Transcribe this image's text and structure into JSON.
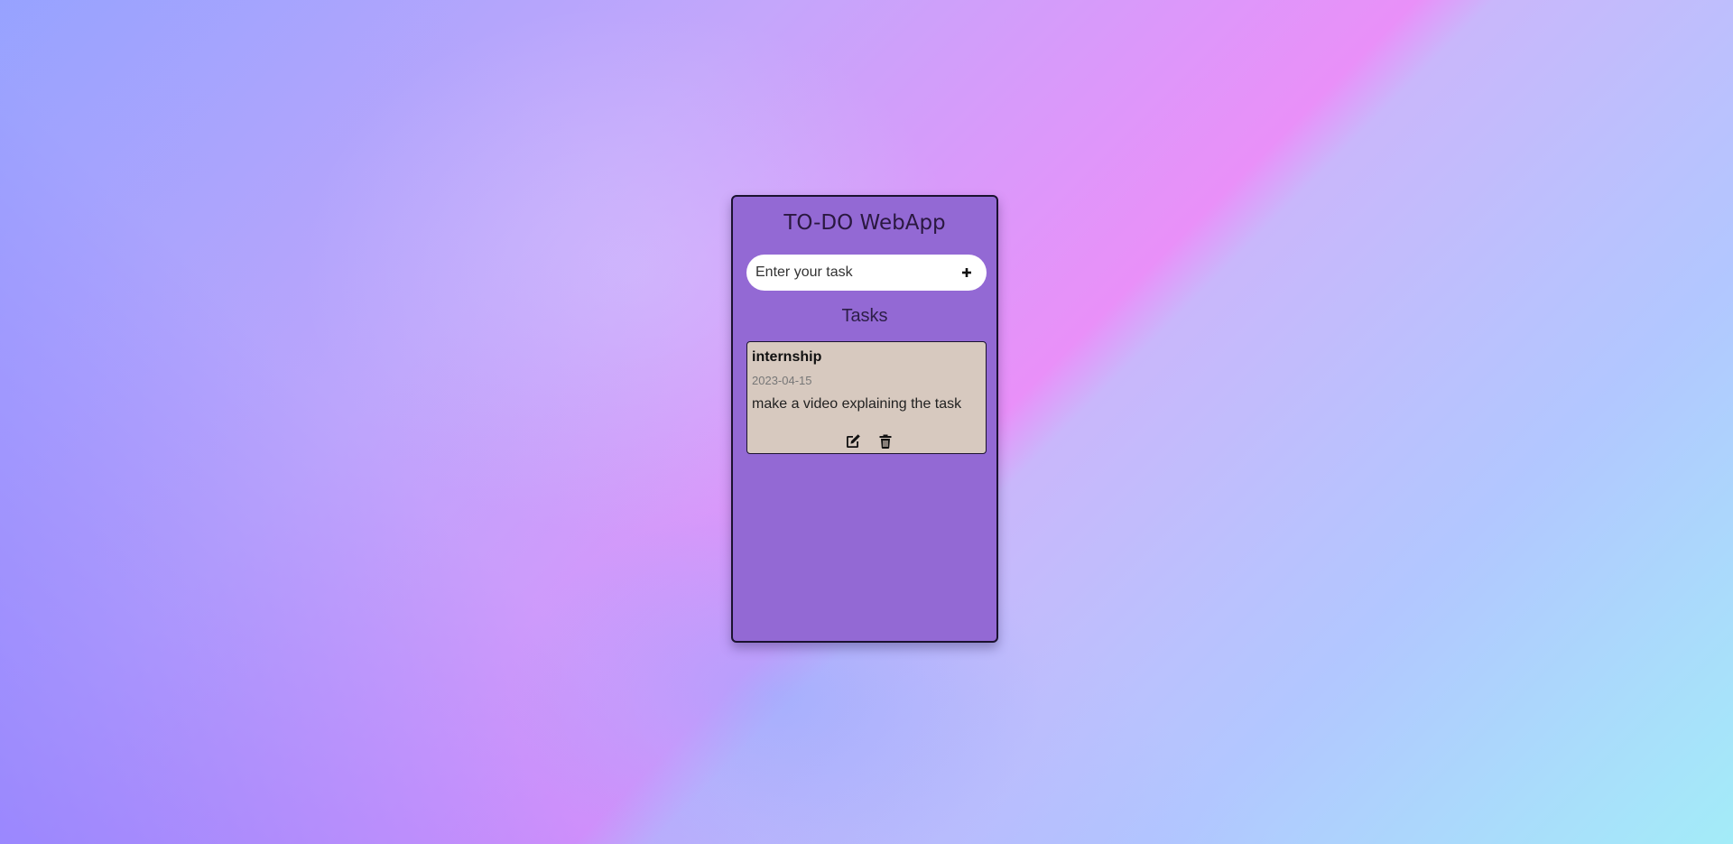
{
  "app": {
    "title": "TO-DO WebApp"
  },
  "input": {
    "placeholder": "Enter your task",
    "value": "",
    "add_icon": "plus-icon"
  },
  "tasks": {
    "heading": "Tasks",
    "items": [
      {
        "title": "internship",
        "date": "2023-04-15",
        "description": "make a video explaining the task",
        "edit_icon": "edit-icon",
        "delete_icon": "trash-icon"
      }
    ]
  },
  "colors": {
    "card_background": "#9369d4",
    "task_background": "#d7c9bf"
  }
}
